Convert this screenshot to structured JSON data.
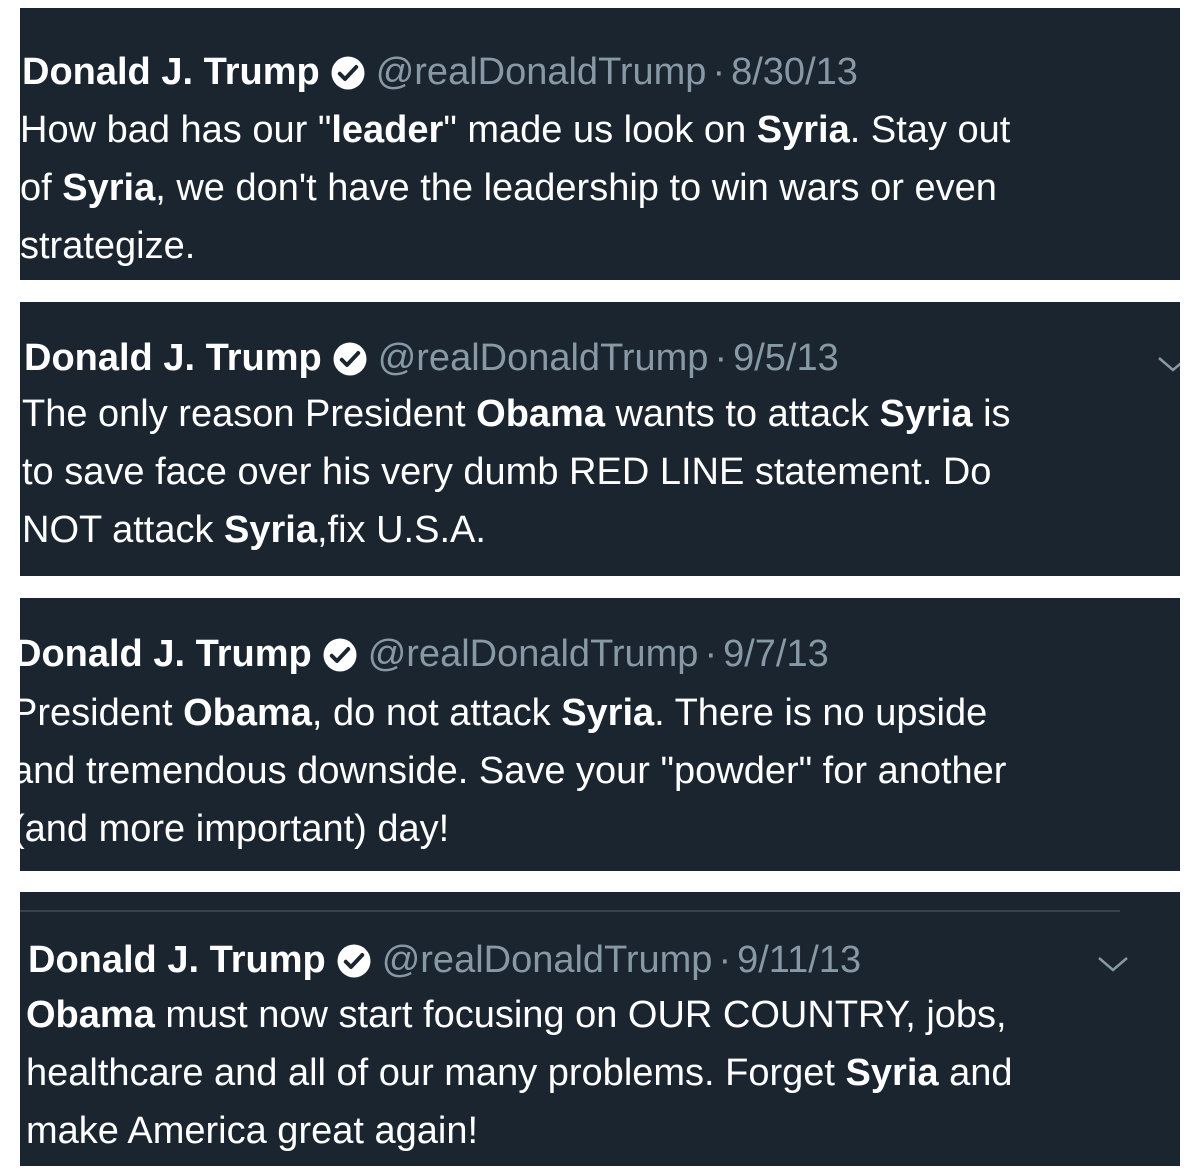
{
  "tweets": [
    {
      "name": "Donald J. Trump",
      "handle": "@realDonaldTrump",
      "separator": "·",
      "date": "8/30/13",
      "lines": [
        [
          "How bad has our \"",
          "leader",
          "\" made us look on ",
          "Syria",
          ". Stay out"
        ],
        [
          "of ",
          "Syria",
          ", we don't have the leadership to win wars or even"
        ],
        [
          "strategize."
        ]
      ]
    },
    {
      "name": "Donald J. Trump",
      "handle": "@realDonaldTrump",
      "separator": "·",
      "date": "9/5/13",
      "lines": [
        [
          "The only reason President ",
          "Obama",
          " wants to attack ",
          "Syria",
          " is"
        ],
        [
          "to save face over his very dumb RED LINE statement. Do"
        ],
        [
          "NOT attack ",
          "Syria",
          ",fix U.S.A."
        ]
      ]
    },
    {
      "name": "Donald J. Trump",
      "handle": "@realDonaldTrump",
      "separator": "·",
      "date": "9/7/13",
      "lines": [
        [
          "President ",
          "Obama",
          ", do not attack ",
          "Syria",
          ". There is no upside"
        ],
        [
          "and tremendous downside. Save your \"powder\" for another"
        ],
        [
          "(and more important) day!"
        ]
      ]
    },
    {
      "name": "Donald J. Trump",
      "handle": "@realDonaldTrump",
      "separator": "·",
      "date": "9/11/13",
      "lines": [
        [
          "",
          "Obama",
          " must now start focusing on OUR COUNTRY, jobs,"
        ],
        [
          "healthcare and all of our many problems. Forget ",
          "Syria",
          " and"
        ],
        [
          "make America great again!"
        ]
      ]
    }
  ],
  "icons": {
    "verified": "verified-badge-icon",
    "chevron": "chevron-down-icon"
  },
  "colors": {
    "card_background": "#1b2530",
    "text": "#ffffff",
    "secondary": "#8899a6"
  }
}
